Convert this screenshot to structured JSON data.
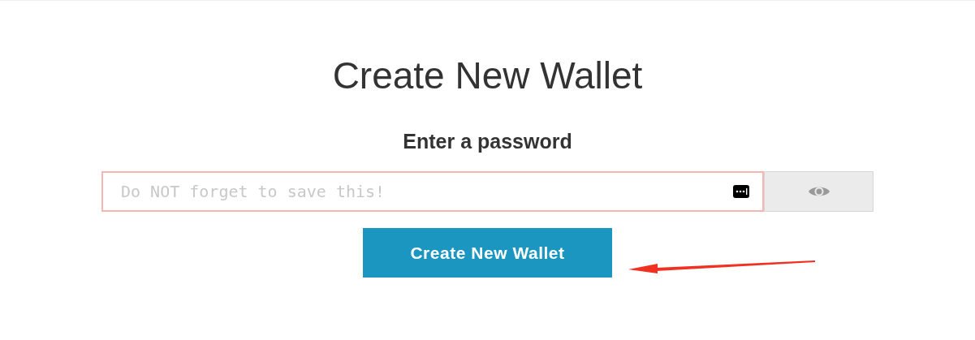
{
  "title": "Create New Wallet",
  "password": {
    "label": "Enter a password",
    "placeholder": "Do NOT forget to save this!"
  },
  "submit": {
    "label": "Create New Wallet"
  }
}
